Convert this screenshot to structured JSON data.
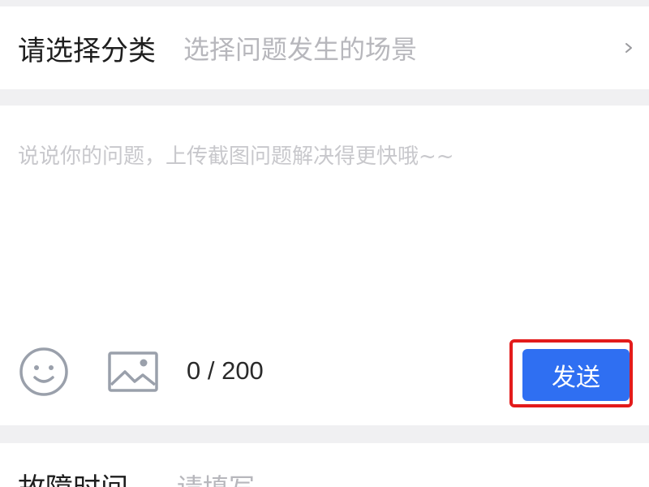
{
  "category": {
    "label": "请选择分类",
    "placeholder": "选择问题发生的场景",
    "chevron_icon": "chevron-right-icon"
  },
  "feedback": {
    "placeholder": "说说你的问题，上传截图问题解决得更快哦~~",
    "emoji_icon": "emoji-icon",
    "image_icon": "image-icon",
    "counter": "0 / 200",
    "send_label": "发送"
  },
  "fault_time": {
    "label": "故障时间",
    "placeholder": "请填写"
  },
  "colors": {
    "accent": "#2f6ff2",
    "highlight": "#e31b1b",
    "placeholder": "#b7b7bc",
    "background": "#f0f0f2"
  }
}
